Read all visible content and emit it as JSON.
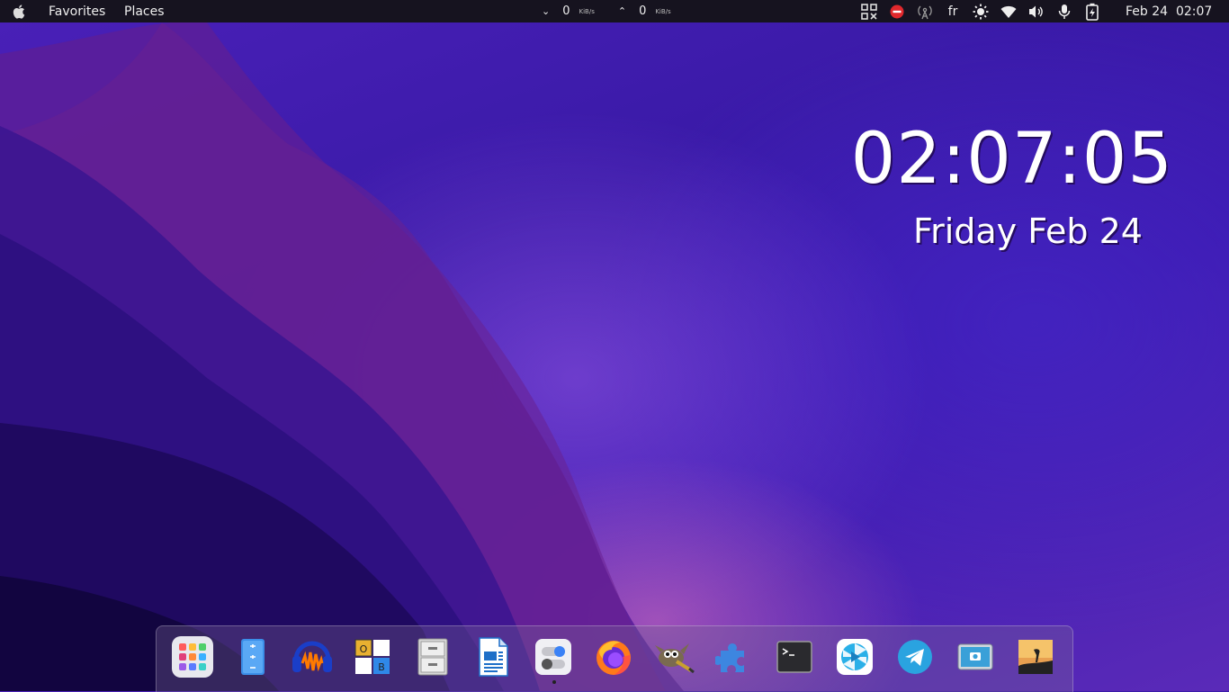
{
  "topbar": {
    "apple_icon": "apple-logo-icon",
    "favorites": "Favorites",
    "places": "Places",
    "net": {
      "down_value": "0",
      "down_unit": "KiB/s",
      "up_value": "0",
      "up_unit": "KiB/s"
    },
    "tray_icons": [
      "qr-grid-icon",
      "do-not-disturb-icon",
      "antenna-icon",
      "language",
      "brightness-icon",
      "wifi-icon",
      "volume-icon",
      "microphone-icon",
      "battery-charging-icon"
    ],
    "language": "fr",
    "datetime": "Feb 24  02:07"
  },
  "desktop_clock": {
    "time": "02:07:05",
    "date": "Friday Feb 24"
  },
  "dock": {
    "apps": [
      "app-grid",
      "text-editor",
      "audacity",
      "obs",
      "file-cabinet",
      "libreoffice-writer",
      "settings-toggles",
      "firefox",
      "gimp",
      "extensions",
      "terminal",
      "kodi-like-player",
      "telegram",
      "screenshot",
      "photo-viewer"
    ],
    "running_indicator": "settings-toggles",
    "colors": {
      "firefox": "#ff7a1a",
      "telegram": "#2aa3e0",
      "extensions": "#3d86e0",
      "audacity": "#1a3ec8"
    }
  }
}
